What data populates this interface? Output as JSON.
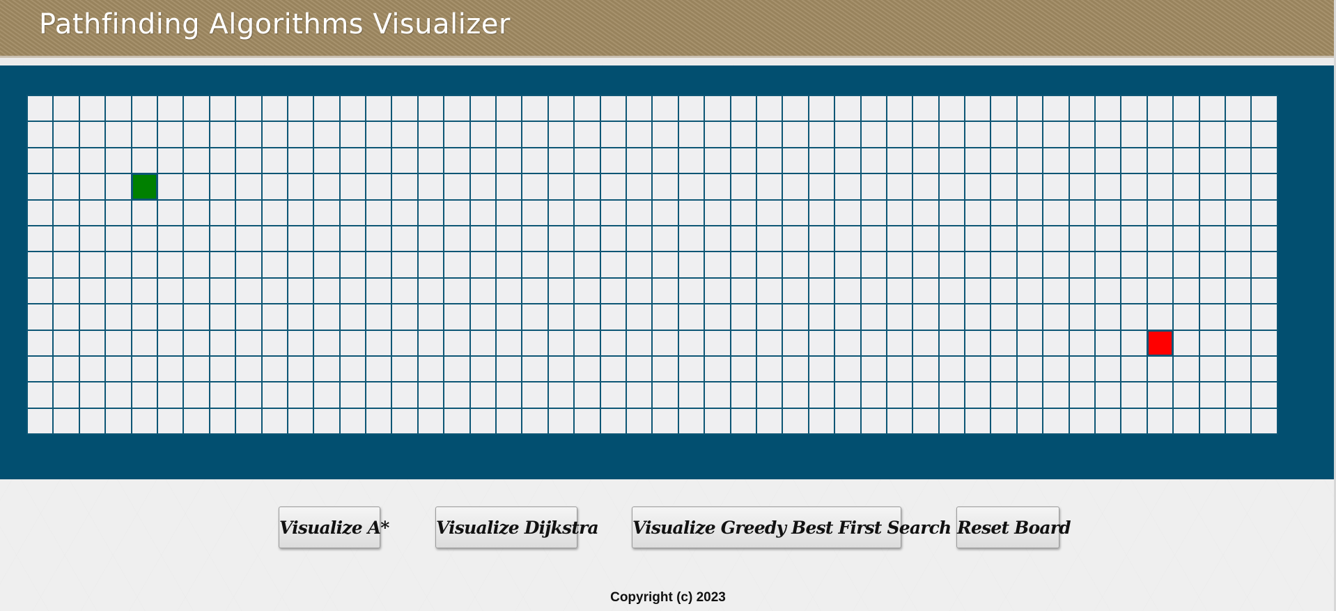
{
  "header": {
    "title": "Pathfinding Algorithms Visualizer"
  },
  "board": {
    "rows": 13,
    "cols": 48,
    "start": {
      "row": 3,
      "col": 4
    },
    "target": {
      "row": 9,
      "col": 43
    },
    "colors": {
      "panel": "#024f70",
      "cell": "#efeff1",
      "cell_border": "#0d5675",
      "start": "#008000",
      "target": "#ff0000"
    }
  },
  "controls": {
    "astar_label": "Visualize A*",
    "dijkstra_label": "Visualize Dijkstra",
    "greedy_label": "Visualize Greedy Best First Search",
    "reset_label": "Reset Board"
  },
  "footer": {
    "copyright": "Copyright (c) 2023"
  }
}
